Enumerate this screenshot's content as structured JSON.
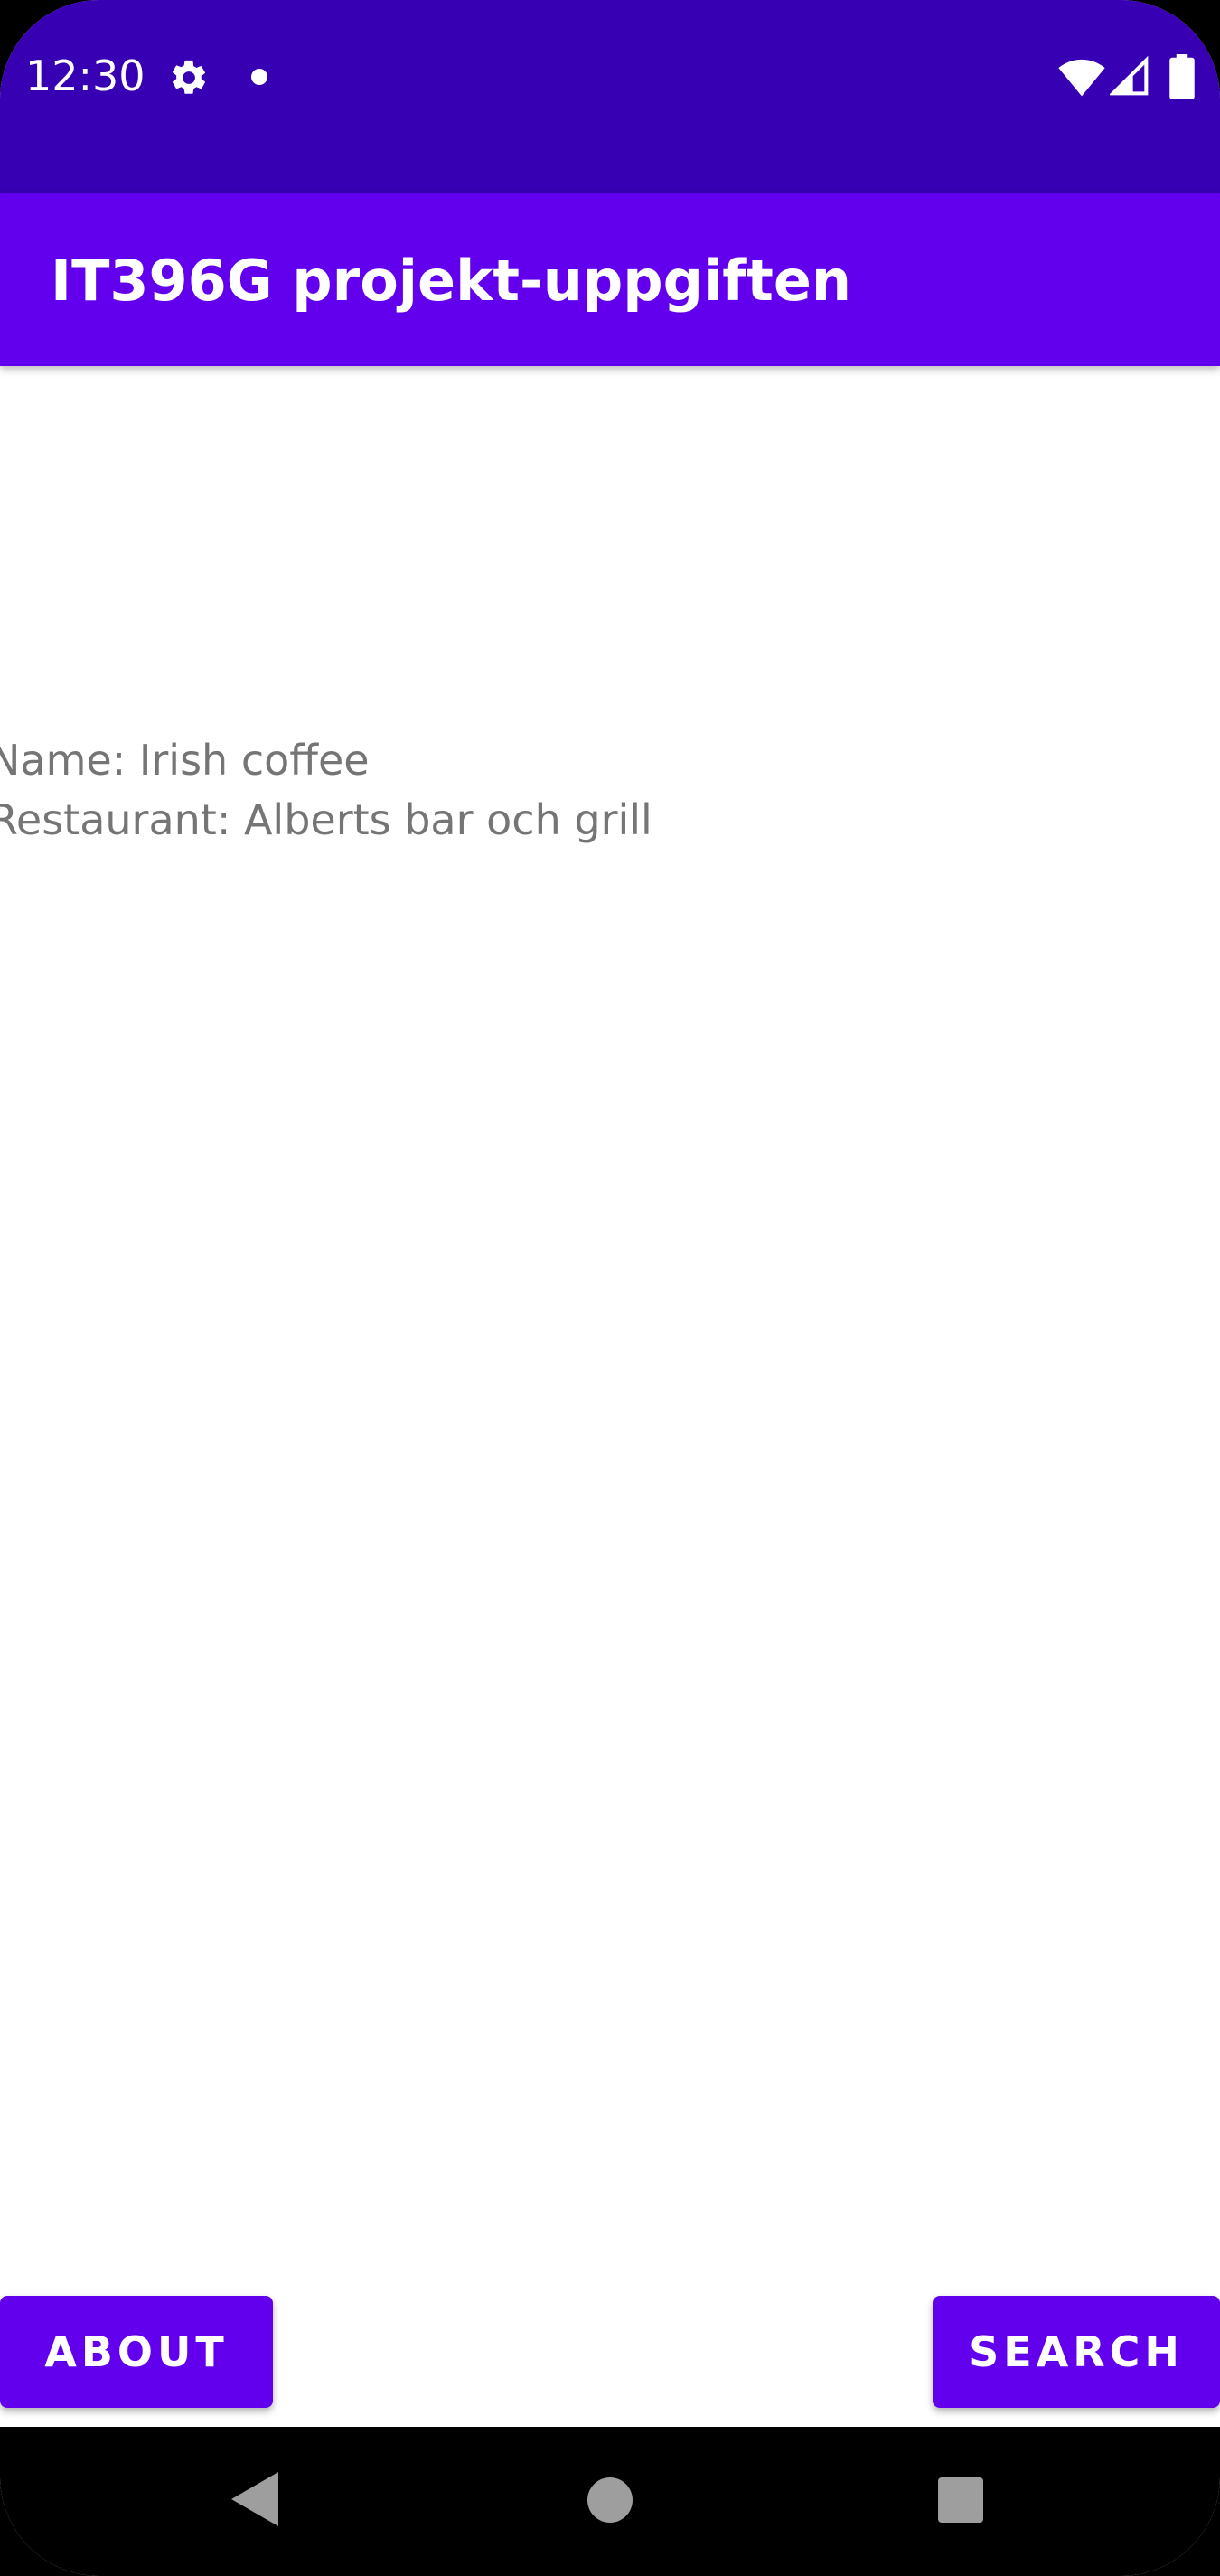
{
  "status_bar": {
    "time": "12:30",
    "icons": [
      "gear-icon",
      "notification-dot-icon",
      "wifi-icon",
      "signal-icon",
      "battery-icon"
    ]
  },
  "app_bar": {
    "title": "IT396G projekt-uppgiften"
  },
  "content": {
    "name_line": "Name: Irish coffee",
    "restaurant_line": "Restaurant: Alberts bar och grill"
  },
  "buttons": {
    "about_label": "ABOUT",
    "search_label": "SEARCH"
  },
  "nav_bar": {
    "icons": [
      "back-icon",
      "home-icon",
      "recents-icon"
    ]
  },
  "colors": {
    "status_bar": "#3700b3",
    "primary": "#6200ee",
    "text_secondary": "#757575",
    "nav_bar": "#000000"
  }
}
